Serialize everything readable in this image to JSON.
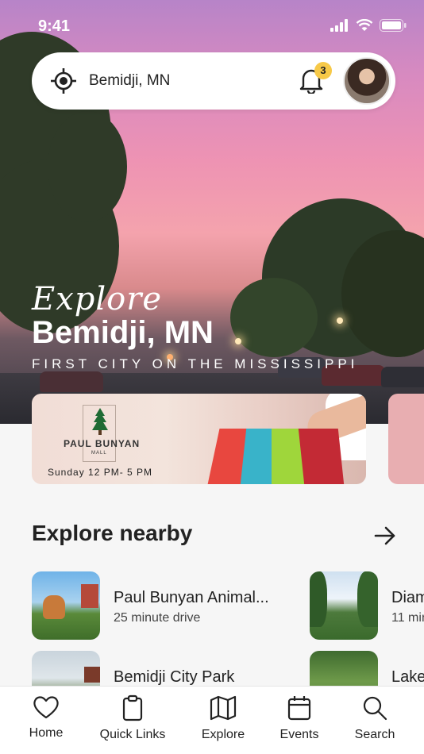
{
  "status_bar": {
    "time": "9:41"
  },
  "search_bar": {
    "location": "Bemidji, MN",
    "notification_count": "3"
  },
  "hero": {
    "script_text": "Explore",
    "title": "Bemidji, MN",
    "subtitle": "FIRST CITY ON THE MISSISSIPPI"
  },
  "promo": {
    "logo_main": "PAUL BUNYAN",
    "logo_small": "MALL",
    "hours": "Sunday 12 PM- 5 PM"
  },
  "explore_nearby": {
    "title": "Explore nearby",
    "items": [
      {
        "name": "Paul Bunyan Animal...",
        "distance": "25 minute drive"
      },
      {
        "name": "Diam",
        "distance": "11 min"
      },
      {
        "name": "Bemidji City Park",
        "distance": ""
      },
      {
        "name": "Lake",
        "distance": ""
      }
    ]
  },
  "tab_bar": {
    "tabs": [
      {
        "label": "Home",
        "icon": "heart-icon"
      },
      {
        "label": "Quick Links",
        "icon": "clipboard-icon"
      },
      {
        "label": "Explore",
        "icon": "map-icon"
      },
      {
        "label": "Events",
        "icon": "calendar-icon"
      },
      {
        "label": "Search",
        "icon": "search-icon"
      }
    ]
  }
}
